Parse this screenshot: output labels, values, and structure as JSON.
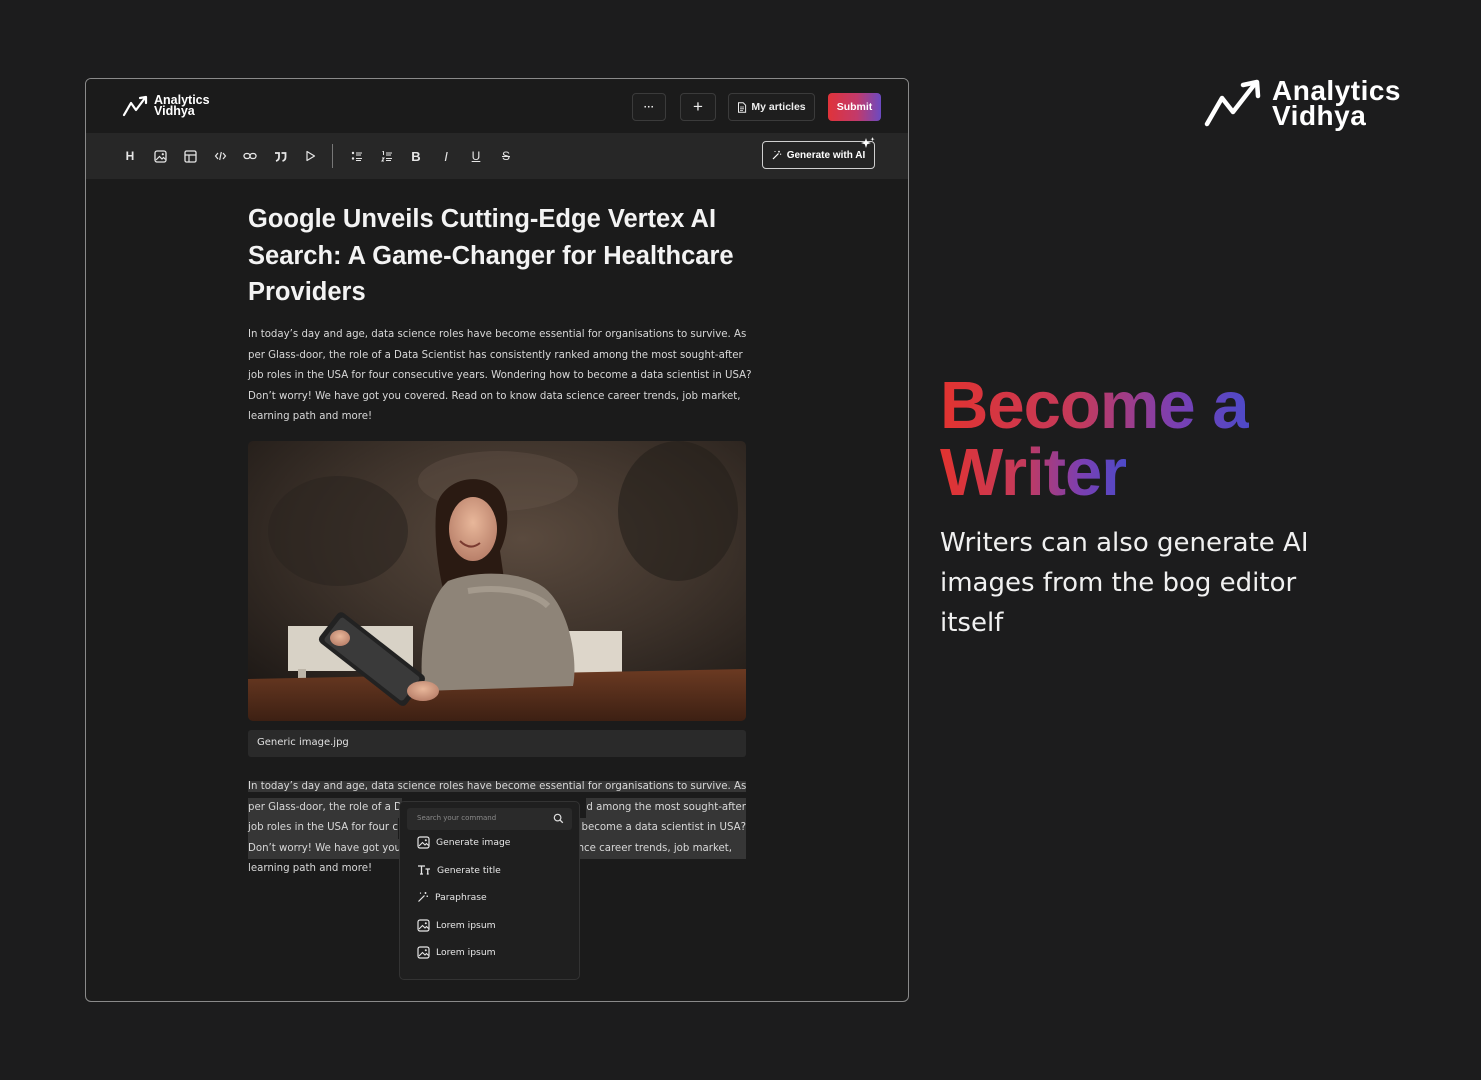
{
  "editor": {
    "brand": {
      "line1": "Analytics",
      "line2": "Vidhya"
    },
    "topbar": {
      "more_label": "···",
      "add_label": "+",
      "my_articles_label": "My articles",
      "submit_label": "Submit"
    },
    "toolbar": {
      "tools": [
        "heading-icon",
        "image-icon",
        "table-icon",
        "code-icon",
        "link-icon",
        "quote-icon",
        "play-icon",
        "bulleted-list-icon",
        "numbered-list-icon",
        "bold-icon",
        "italic-icon",
        "underline-icon",
        "strikethrough-icon"
      ],
      "heading_glyph": "H",
      "bold_glyph": "B",
      "italic_glyph": "I",
      "underline_glyph": "U",
      "strike_glyph": "S",
      "generate_ai_label": "Generate with AI"
    },
    "article": {
      "title": "Google Unveils Cutting-Edge Vertex AI Search: A Game-Changer for Healthcare Providers",
      "paragraph": "In today’s day and age, data science roles have become essential for organisations to survive. As per Glass-door, the role of a Data Scientist has consistently ranked among the most sought-after job roles in the USA for four consecutive years. Wondering how to become a data scientist in USA? Don’t worry! We have got you covered. Read on to know data science career trends, job market, learning path and more!",
      "image_caption": "Generic image.jpg",
      "paragraph2": {
        "line1": "In today’s day and age, data science roles have become essential for organisations to survive. As",
        "line2a": "per Glass-door, the role of a D",
        "line2b": "d among the most sought-after",
        "line3a": "job roles in the USA for four c",
        "line3b": "o become a data scientist in USA?",
        "line4a": "Don’t worry! We have got you",
        "line4b": "nce career trends, job market,",
        "line5": "learning path and more!"
      }
    },
    "command_popup": {
      "search_placeholder": "Search your command",
      "items": [
        {
          "label": "Generate image",
          "icon": "image-icon"
        },
        {
          "label": "Generate title",
          "icon": "text-title-icon"
        },
        {
          "label": "Paraphrase",
          "icon": "magic-wand-icon"
        },
        {
          "label": "Lorem ipsum",
          "icon": "image-icon"
        },
        {
          "label": "Lorem ipsum",
          "icon": "image-icon"
        }
      ]
    }
  },
  "promo": {
    "brand": {
      "line1": "Analytics",
      "line2": "Vidhya"
    },
    "headline_line1": "Become a",
    "headline_line2": "Writer",
    "subline": "Writers can also generate AI images from the bog editor itself"
  },
  "colors": {
    "background": "#1c1c1d",
    "submit_gradient_start": "#e0333a",
    "submit_gradient_end": "#6b4ac2",
    "headline_red": "#e23330",
    "headline_violet": "#4d4ac9"
  }
}
